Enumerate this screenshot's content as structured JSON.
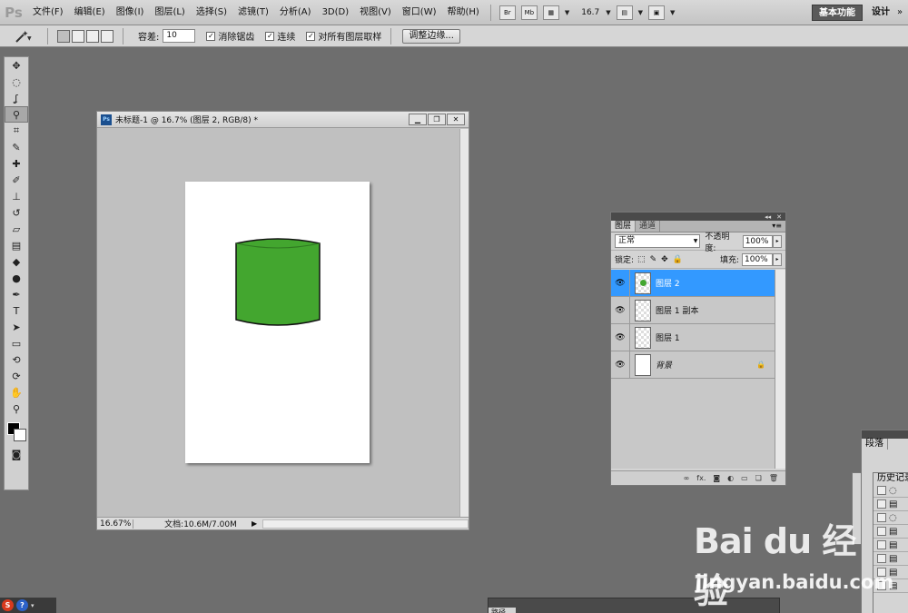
{
  "app": {
    "logo": "Ps"
  },
  "menu": [
    {
      "label": "文件(F)"
    },
    {
      "label": "编辑(E)"
    },
    {
      "label": "图像(I)"
    },
    {
      "label": "图层(L)"
    },
    {
      "label": "选择(S)"
    },
    {
      "label": "滤镜(T)"
    },
    {
      "label": "分析(A)"
    },
    {
      "label": "3D(D)"
    },
    {
      "label": "视图(V)"
    },
    {
      "label": "窗口(W)"
    },
    {
      "label": "帮助(H)"
    }
  ],
  "menubar_tools": {
    "bridge": "Br",
    "minibridge": "Mb",
    "zoom": "16.7",
    "workspace_active": "基本功能",
    "workspace_design": "设计",
    "workspace_more": "»"
  },
  "options": {
    "tolerance_label": "容差:",
    "tolerance_value": "10",
    "antialias_label": "消除锯齿",
    "antialias_checked": true,
    "contiguous_label": "连续",
    "contiguous_checked": true,
    "sample_all_label": "对所有图层取样",
    "sample_all_checked": true,
    "refine_edge_label": "调整边缘..."
  },
  "document": {
    "title": "未标题-1 @ 16.7% (图层 2, RGB/8) *",
    "status_zoom": "16.67%",
    "status_doc": "文档:10.6M/7.00M"
  },
  "canvas": {
    "shape_color": "#43a62f",
    "paper_color": "#ffffff"
  },
  "layers_panel": {
    "tabs": [
      {
        "label": "图层"
      },
      {
        "label": "通道"
      }
    ],
    "blend_mode": "正常",
    "opacity_label": "不透明度:",
    "opacity_value": "100%",
    "lock_label": "锁定:",
    "fill_label": "填充:",
    "fill_value": "100%",
    "layers": [
      {
        "name": "图层 2",
        "selected": true
      },
      {
        "name": "图层 1 副本",
        "selected": false
      },
      {
        "name": "图层 1",
        "selected": false
      },
      {
        "name": "背景",
        "selected": false
      }
    ]
  },
  "right_panels": {
    "paragraph_tab": "段落",
    "history_tab": "历史记录"
  },
  "bottom_panel": {
    "tab": "路径"
  },
  "watermark": {
    "logo": "Bai du 经验",
    "url": "jingyan.baidu.com"
  },
  "colors": {
    "selected_layer": "#3399ff",
    "workspace_bg": "#6e6e6e"
  }
}
